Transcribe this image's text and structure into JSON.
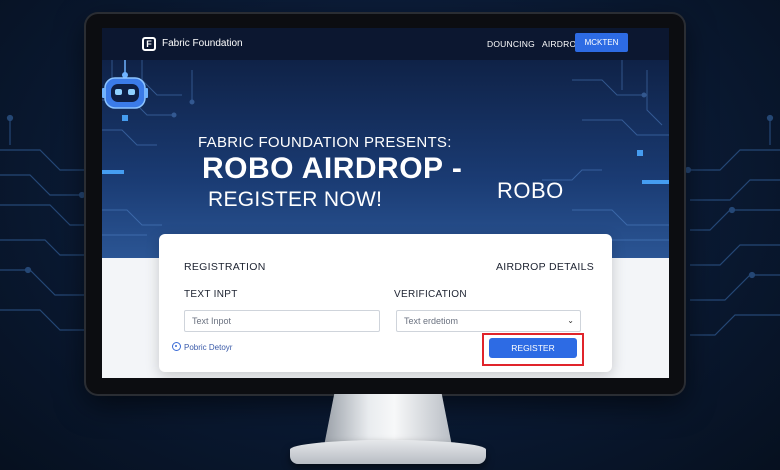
{
  "nav": {
    "brand": "Fabric Foundation",
    "logo_letter": "F",
    "links": [
      "DOUNCING",
      "AIRDROP"
    ],
    "button_label": "MCKTEN"
  },
  "hero": {
    "pretitle": "FABRIC FOUNDATION PRESENTS:",
    "title": "ROBO AIRDROP -",
    "subtitle": "REGISTER NOW!",
    "robo_label": "ROBO",
    "robot_icon": "robot-icon"
  },
  "card": {
    "left_heading": "REGISTRATION",
    "right_heading": "AIRDROP DETAILS",
    "text_input": {
      "label": "TEXT INPT",
      "placeholder": "Text Inpot"
    },
    "verification": {
      "label": "VERIFICATION",
      "value": "Text erdetiom",
      "chevron": "⌄"
    },
    "helper_text": "Pobric Detoyr",
    "register_label": "REGISTER"
  },
  "colors": {
    "accent_blue": "#2d6be4",
    "nav_bg": "#0c1730",
    "highlight_red": "#e0242b"
  }
}
